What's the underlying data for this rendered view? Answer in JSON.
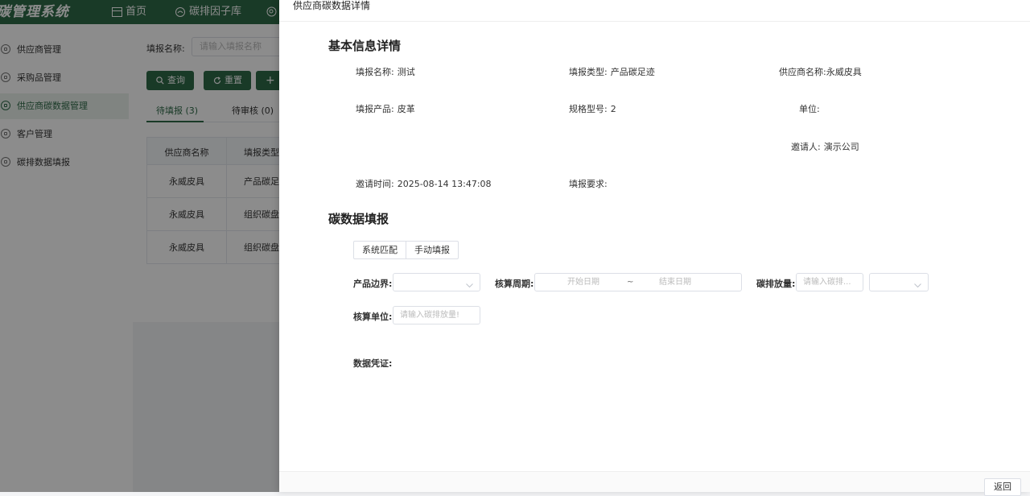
{
  "app": {
    "brand": "碳管理系统",
    "nav": [
      {
        "label": "首页",
        "icon": "home-icon"
      },
      {
        "label": "碳排因子库",
        "icon": "cloud-icon"
      }
    ]
  },
  "sidebar": {
    "items": [
      {
        "label": "供应商管理"
      },
      {
        "label": "采购品管理"
      },
      {
        "label": "供应商碳数据管理",
        "active": true
      },
      {
        "label": "客户管理"
      },
      {
        "label": "碳排数据填报"
      }
    ]
  },
  "list": {
    "filter_label": "填报名称:",
    "filter_placeholder": "请输入填报名称",
    "query_label": "查询",
    "reset_label": "重置",
    "add_label": "+",
    "tabs": [
      "待填报 (3)",
      "待审核 (0)"
    ],
    "columns": [
      "供应商名称",
      "填报类型"
    ],
    "rows": [
      [
        "永威皮具",
        "产品碳足"
      ],
      [
        "永威皮具",
        "组织碳盘"
      ],
      [
        "永威皮具",
        "组织碳盘"
      ]
    ]
  },
  "drawer": {
    "title": "供应商碳数据详情",
    "basic_title": "基本信息详情",
    "fields": {
      "name_label": "填报名称:",
      "name_value": "测试",
      "type_label": "填报类型:",
      "type_value": "产品碳足迹",
      "supplier_label": "供应商名称:",
      "supplier_value": "永威皮具",
      "product_label": "填报产品:",
      "product_value": "皮革",
      "model_label": "规格型号:",
      "model_value": "2",
      "unit_label": "单位:",
      "unit_value": "",
      "inviter_label": "邀请人:",
      "inviter_value": "演示公司",
      "invite_time_label": "邀请时间:",
      "invite_time_value": "2025-08-14 13:47:08",
      "requirement_label": "填报要求:",
      "requirement_value": ""
    },
    "carbon_title": "碳数据填报",
    "modes": [
      "系统匹配",
      "手动填报"
    ],
    "form": {
      "boundary_label": "产品边界:",
      "period_label": "核算周期:",
      "start_placeholder": "开始日期",
      "range_sep": "~",
      "end_placeholder": "结束日期",
      "emission_label": "碳排放量:",
      "emission_placeholder": "请输入碳排...",
      "unit_label": "核算单位:",
      "unit_placeholder": "请输入碳排放量!",
      "evidence_label": "数据凭证:"
    },
    "back_label": "返回"
  },
  "colors": {
    "brand_green": "#2f6a48"
  }
}
